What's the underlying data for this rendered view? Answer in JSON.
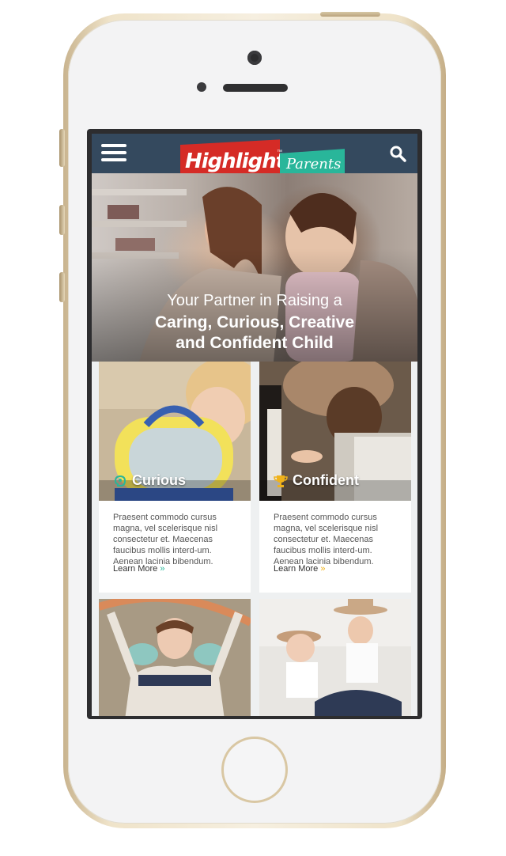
{
  "header": {
    "logo_text": "Highlights",
    "logo_tm": "™",
    "logo_sub": "Parents"
  },
  "hero": {
    "line1": "Your Partner in Raising a",
    "line2": "Caring, Curious, Creative",
    "line3": "and Confident Child"
  },
  "cards": [
    {
      "title": "Curious",
      "icon": "brain-icon",
      "body": "Praesent commodo cursus magna, vel scelerisque nisl consectetur et. Maecenas faucibus mollis interd-um. Aenean lacinia bibendum.",
      "link": "Learn More",
      "arrow": "»",
      "accent": "#29b69a"
    },
    {
      "title": "Confident",
      "icon": "trophy-icon",
      "body": "Praesent commodo cursus magna, vel scelerisque nisl consectetur et. Maecenas faucibus mollis interd-um. Aenean lacinia bibendum.",
      "link": "Learn More",
      "arrow": "»",
      "accent": "#f0b21a"
    }
  ],
  "colors": {
    "navbar": "#34495e",
    "logo_red": "#d52b26",
    "logo_teal": "#29b69a"
  }
}
